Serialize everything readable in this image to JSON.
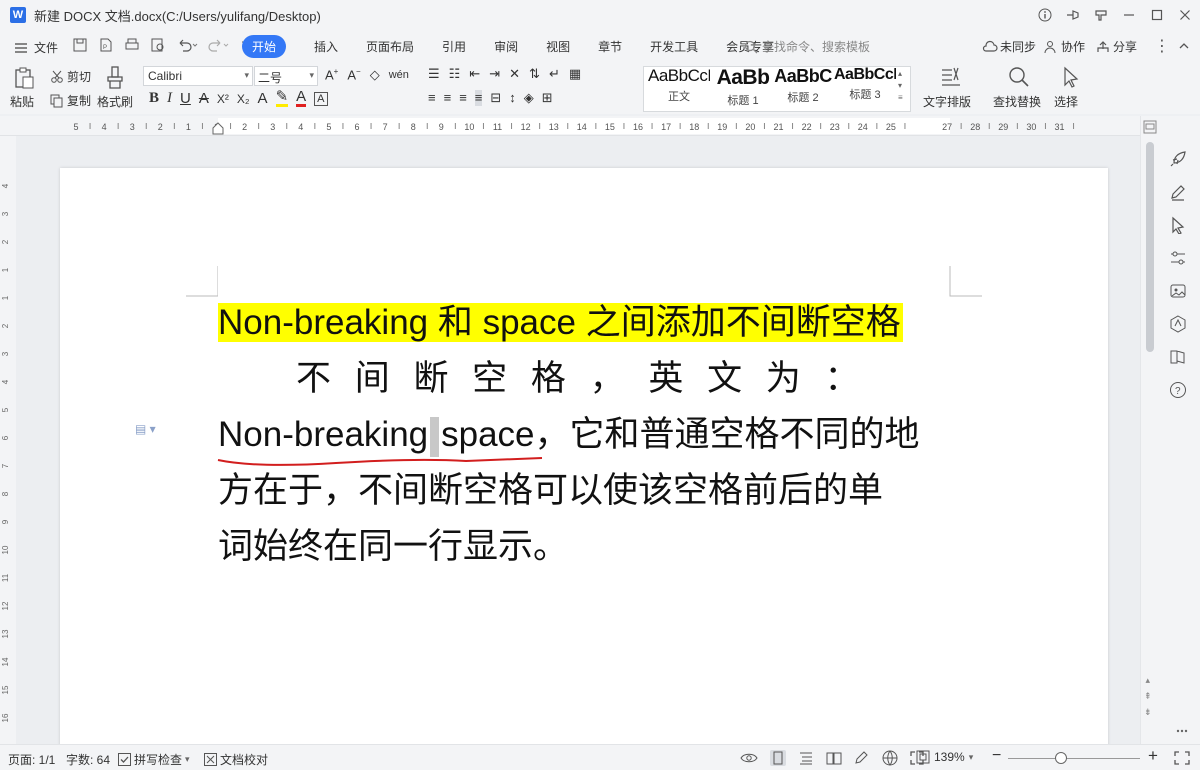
{
  "window": {
    "app_logo": "W",
    "title": "新建 DOCX 文档.docx(C:/Users/yulifang/Desktop)"
  },
  "menubar": {
    "file": "文件",
    "tabs": [
      "开始",
      "插入",
      "页面布局",
      "引用",
      "审阅",
      "视图",
      "章节",
      "开发工具",
      "会员专享"
    ],
    "active_tab": "开始",
    "search_placeholder": "查找命令、搜索模板",
    "sync": "未同步",
    "collab": "协作",
    "share": "分享"
  },
  "ribbon": {
    "paste": "粘贴",
    "cut": "剪切",
    "copy": "复制",
    "format_painter": "格式刷",
    "font_name": "Calibri",
    "font_size": "二号",
    "styles": [
      {
        "sample": "AaBbCcDd",
        "label": "正文"
      },
      {
        "sample": "AaBb",
        "label": "标题 1"
      },
      {
        "sample": "AaBbC",
        "label": "标题 2"
      },
      {
        "sample": "AaBbCcD",
        "label": "标题 3"
      }
    ],
    "text_layout": "文字排版",
    "find_replace": "查找替换",
    "select": "选择"
  },
  "ruler": {
    "numbers": [
      "5",
      "4",
      "3",
      "2",
      "1",
      "1",
      "2",
      "3",
      "4",
      "5",
      "6",
      "7",
      "8",
      "9",
      "10",
      "11",
      "12",
      "13",
      "14",
      "15",
      "16",
      "17",
      "18",
      "19",
      "20",
      "21",
      "22",
      "23",
      "24",
      "25",
      "27",
      "28",
      "29",
      "30",
      "31"
    ],
    "vnumbers": [
      "4",
      "3",
      "2",
      "1",
      "1",
      "2",
      "3",
      "4",
      "5",
      "6",
      "7",
      "8",
      "9",
      "10",
      "11",
      "12",
      "13",
      "14",
      "15",
      "16"
    ]
  },
  "document": {
    "heading_pre": "Non-breaking",
    "heading_mid1": " 和 ",
    "heading_space": "space",
    "heading_post": " 之间添加不间断空格",
    "line2": "不 间 断 空 格 ， 英 文 为 ：",
    "line3_a": "Non-breaking",
    "line3_b": "space",
    "line3_c": "，它和普通空格不同的地",
    "line4": "方在于，不间断空格可以使该空格前后的单",
    "line5": "词始终在同一行显示。",
    "highlight_color": "#ffff00"
  },
  "status": {
    "page": "页面: 1/1",
    "words": "字数: 64",
    "spellcheck": "拼写检查",
    "doc_proof": "文档校对",
    "zoom": "139%",
    "zoom_level": 0.4
  }
}
